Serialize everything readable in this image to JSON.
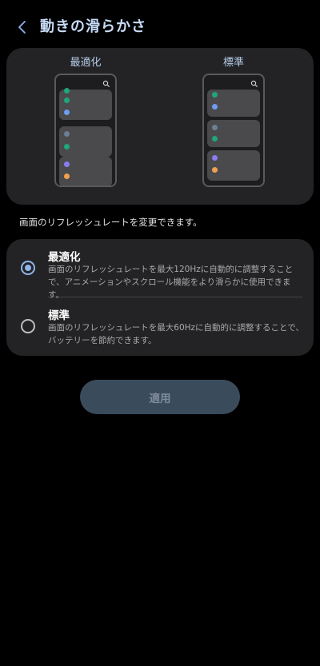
{
  "header": {
    "back_icon": "chevron-left-icon",
    "title": "動きの滑らかさ"
  },
  "preview": {
    "optimized_label": "最適化",
    "standard_label": "標準",
    "search_icon": "search-icon"
  },
  "description": "画面のリフレッシュレートを変更できます。",
  "options": [
    {
      "title": "最適化",
      "description": "画面のリフレッシュレートを最大120Hzに自動的に調整することで、アニメーションやスクロール機能をより滑らかに使用できます。",
      "selected": true
    },
    {
      "title": "標準",
      "description": "画面のリフレッシュレートを最大60Hzに自動的に調整することで、バッテリーを節約できます。",
      "selected": false
    }
  ],
  "apply_button": {
    "label": "適用",
    "enabled": false
  },
  "colors": {
    "accent": "#8fb5ea",
    "card_bg": "#232325",
    "green": "#1fa67a",
    "blue": "#6f9cf0",
    "gray_blue": "#6b7f95",
    "purple": "#8a7cf0",
    "orange": "#f0a050"
  }
}
